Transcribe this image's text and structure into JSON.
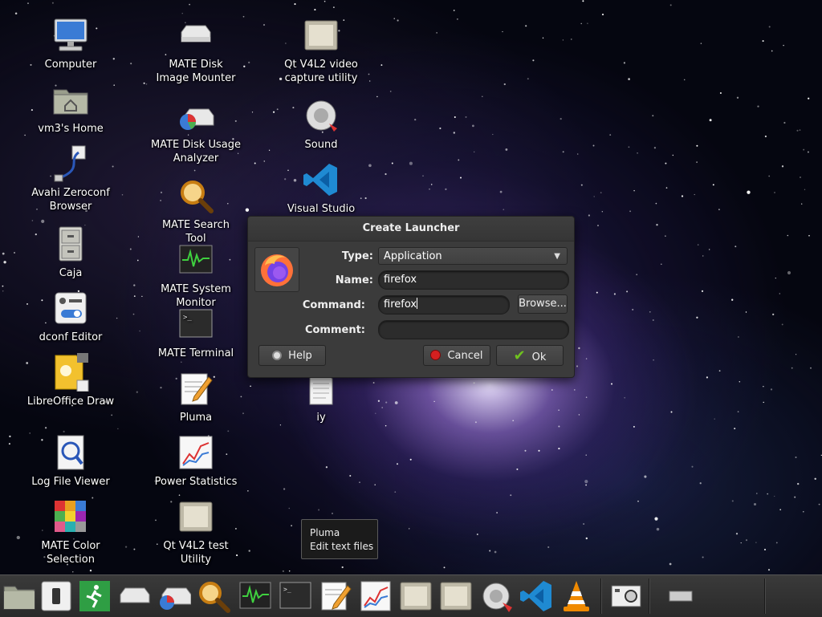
{
  "desktop": {
    "icons": [
      {
        "label": "Computer"
      },
      {
        "label": "vm3's Home"
      },
      {
        "label": "Avahi Zeroconf Browser"
      },
      {
        "label": "Caja"
      },
      {
        "label": "dconf Editor"
      },
      {
        "label": "LibreOffice Draw"
      },
      {
        "label": "Log File Viewer"
      },
      {
        "label": "MATE Color Selection"
      },
      {
        "label": "MATE Disk Image Mounter"
      },
      {
        "label": "MATE Disk Usage Analyzer"
      },
      {
        "label": "MATE Search Tool"
      },
      {
        "label": "MATE System Monitor"
      },
      {
        "label": "MATE Terminal"
      },
      {
        "label": "Pluma"
      },
      {
        "label": "Power Statistics"
      },
      {
        "label": "Qt V4L2 test Utility"
      },
      {
        "label": "Qt V4L2 video capture utility"
      },
      {
        "label": "Sound"
      },
      {
        "label": "Visual Studio Code"
      },
      {
        "label": "iy"
      }
    ]
  },
  "dialog": {
    "title": "Create Launcher",
    "type_label": "Type:",
    "type_value": "Application",
    "name_label": "Name:",
    "name_value": "firefox",
    "command_label": "Command:",
    "command_value": "firefox",
    "browse_label": "Browse...",
    "comment_label": "Comment:",
    "comment_value": "",
    "help_label": "Help",
    "cancel_label": "Cancel",
    "ok_label": "Ok"
  },
  "tooltip": {
    "title": "Pluma",
    "description": "Edit text files"
  },
  "colors": {
    "dialog_bg": "#3b3b3b",
    "panel_bg": "#2f2f2f",
    "ok_check": "#6fc21f",
    "cancel_red": "#d42020"
  }
}
